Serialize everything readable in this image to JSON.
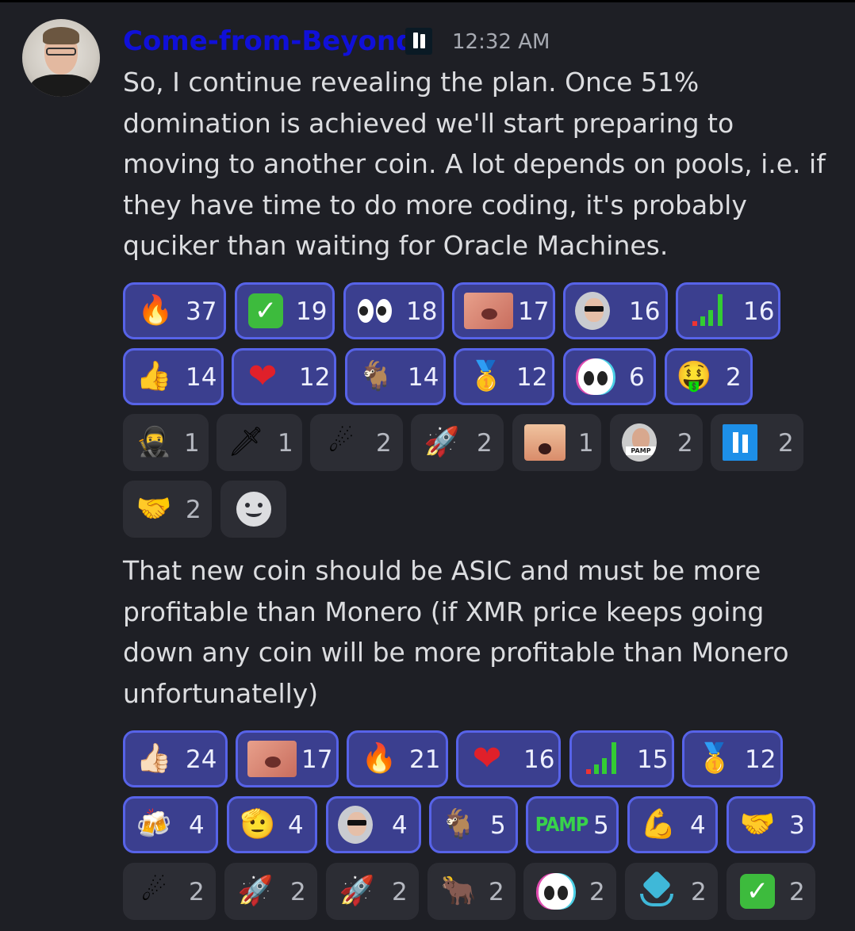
{
  "message": {
    "author": "Come-from-Beyond",
    "timestamp": "12:32 AM",
    "author_color": "#1010d8",
    "paragraphs": [
      "So, I continue revealing the plan. Once 51% domination is achieved we'll start preparing to moving to another coin. A lot depends on pools, i.e. if they have time to do more coding, it's probably quciker than waiting for Oracle Machines.",
      "That new coin should be ASIC and must be more profitable than Monero (if XMR price keeps going down any coin will be more profitable than Monero unfortunatelly)"
    ]
  },
  "reactions1": [
    {
      "emoji": "fire-icon",
      "count": "37",
      "active": true
    },
    {
      "emoji": "check-icon",
      "count": "19",
      "active": true
    },
    {
      "emoji": "eyes-icon",
      "count": "18",
      "active": true
    },
    {
      "emoji": "meme-face-icon",
      "count": "17",
      "active": true
    },
    {
      "emoji": "sunglasses-man-icon",
      "count": "16",
      "active": true
    },
    {
      "emoji": "chart-up-icon",
      "count": "16",
      "active": true
    },
    {
      "emoji": "thumbs-up-icon",
      "count": "14",
      "active": true
    },
    {
      "emoji": "heart-icon",
      "count": "12",
      "active": true
    },
    {
      "emoji": "goat-icon",
      "count": "14",
      "active": true
    },
    {
      "emoji": "medal-icon",
      "count": "12",
      "active": true
    },
    {
      "emoji": "alien-icon",
      "count": "6",
      "active": true
    },
    {
      "emoji": "money-face-icon",
      "count": "2",
      "active": true
    },
    {
      "emoji": "ninja-icon",
      "count": "1",
      "active": false
    },
    {
      "emoji": "dagger-icon",
      "count": "1",
      "active": false
    },
    {
      "emoji": "comet-icon",
      "count": "2",
      "active": false
    },
    {
      "emoji": "rocket-icon",
      "count": "2",
      "active": false
    },
    {
      "emoji": "shouting-face-icon",
      "count": "1",
      "active": false
    },
    {
      "emoji": "pamp-man-icon",
      "count": "2",
      "active": false
    },
    {
      "emoji": "qubic-icon",
      "count": "2",
      "active": false
    },
    {
      "emoji": "handshake-icon",
      "count": "2",
      "active": false
    }
  ],
  "reactions2": [
    {
      "emoji": "thumbs-up-light-icon",
      "count": "24",
      "active": true
    },
    {
      "emoji": "meme-face-icon",
      "count": "17",
      "active": true
    },
    {
      "emoji": "fire-icon",
      "count": "21",
      "active": true
    },
    {
      "emoji": "heart-icon",
      "count": "16",
      "active": true
    },
    {
      "emoji": "chart-up-icon",
      "count": "15",
      "active": true
    },
    {
      "emoji": "medal-icon",
      "count": "12",
      "active": true
    },
    {
      "emoji": "beers-icon",
      "count": "4",
      "active": true
    },
    {
      "emoji": "salute-icon",
      "count": "4",
      "active": true
    },
    {
      "emoji": "sunglasses-man-icon",
      "count": "4",
      "active": true
    },
    {
      "emoji": "goat-icon",
      "count": "5",
      "active": true
    },
    {
      "emoji": "pamp-text-icon",
      "label": "PAMP",
      "count": "5",
      "active": true
    },
    {
      "emoji": "flexed-biceps-icon",
      "count": "4",
      "active": true
    },
    {
      "emoji": "handshake-icon",
      "count": "3",
      "active": true
    },
    {
      "emoji": "comet-icon",
      "count": "2",
      "active": false
    },
    {
      "emoji": "rocket-icon",
      "count": "2",
      "active": false
    },
    {
      "emoji": "rocket-icon",
      "count": "2",
      "active": false
    },
    {
      "emoji": "bull-icon",
      "count": "2",
      "active": false
    },
    {
      "emoji": "alien-icon",
      "count": "2",
      "active": false
    },
    {
      "emoji": "hands-shield-icon",
      "count": "2",
      "active": false
    },
    {
      "emoji": "check-icon",
      "count": "2",
      "active": false
    }
  ],
  "pamp_badge_text": "PAMP"
}
